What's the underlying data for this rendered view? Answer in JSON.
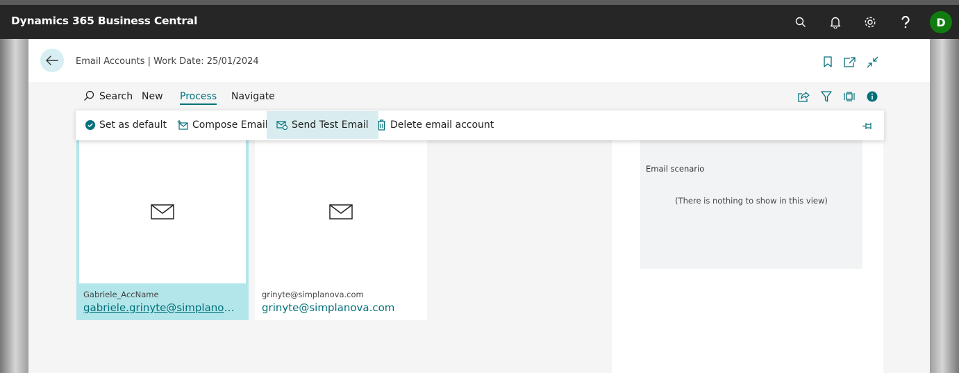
{
  "app": {
    "title": "Dynamics 365 Business Central",
    "user_initial": "D"
  },
  "appbar_icons": [
    "search-icon",
    "bell-icon",
    "gear-icon",
    "help-icon"
  ],
  "header": {
    "caption": "Email Accounts | Work Date: 25/01/2024",
    "icons": [
      "bookmark-icon",
      "open-new-window-icon",
      "collapse-icon"
    ]
  },
  "actionbar": {
    "search_label": "Search",
    "items": [
      "New",
      "Process",
      "Navigate"
    ],
    "active": "Process",
    "right_icons": [
      "share-icon",
      "filter-icon",
      "list-view-icon",
      "info-icon"
    ]
  },
  "process_menu": {
    "items": [
      {
        "label": "Set as default",
        "icon": "check-circle-icon"
      },
      {
        "label": "Compose Email",
        "icon": "compose-email-icon"
      },
      {
        "label": "Send Test Email",
        "icon": "send-test-email-icon",
        "hovered": true
      },
      {
        "label": "Delete email account",
        "icon": "trash-icon"
      }
    ]
  },
  "accounts": [
    {
      "name": "Gabriele_AccName",
      "email": "gabriele.grinyte@simplanova...",
      "selected": true
    },
    {
      "name": "grinyte@simplanova.com",
      "email": "grinyte@simplanova.com",
      "selected": false
    }
  ],
  "factbox": {
    "title": "Email scenario",
    "empty_text": "(There is nothing to show in this view)"
  },
  "colors": {
    "accent": "#00707a",
    "appbar": "#262626",
    "avatar": "#107c10",
    "selected_tile": "#b3e6ea"
  }
}
